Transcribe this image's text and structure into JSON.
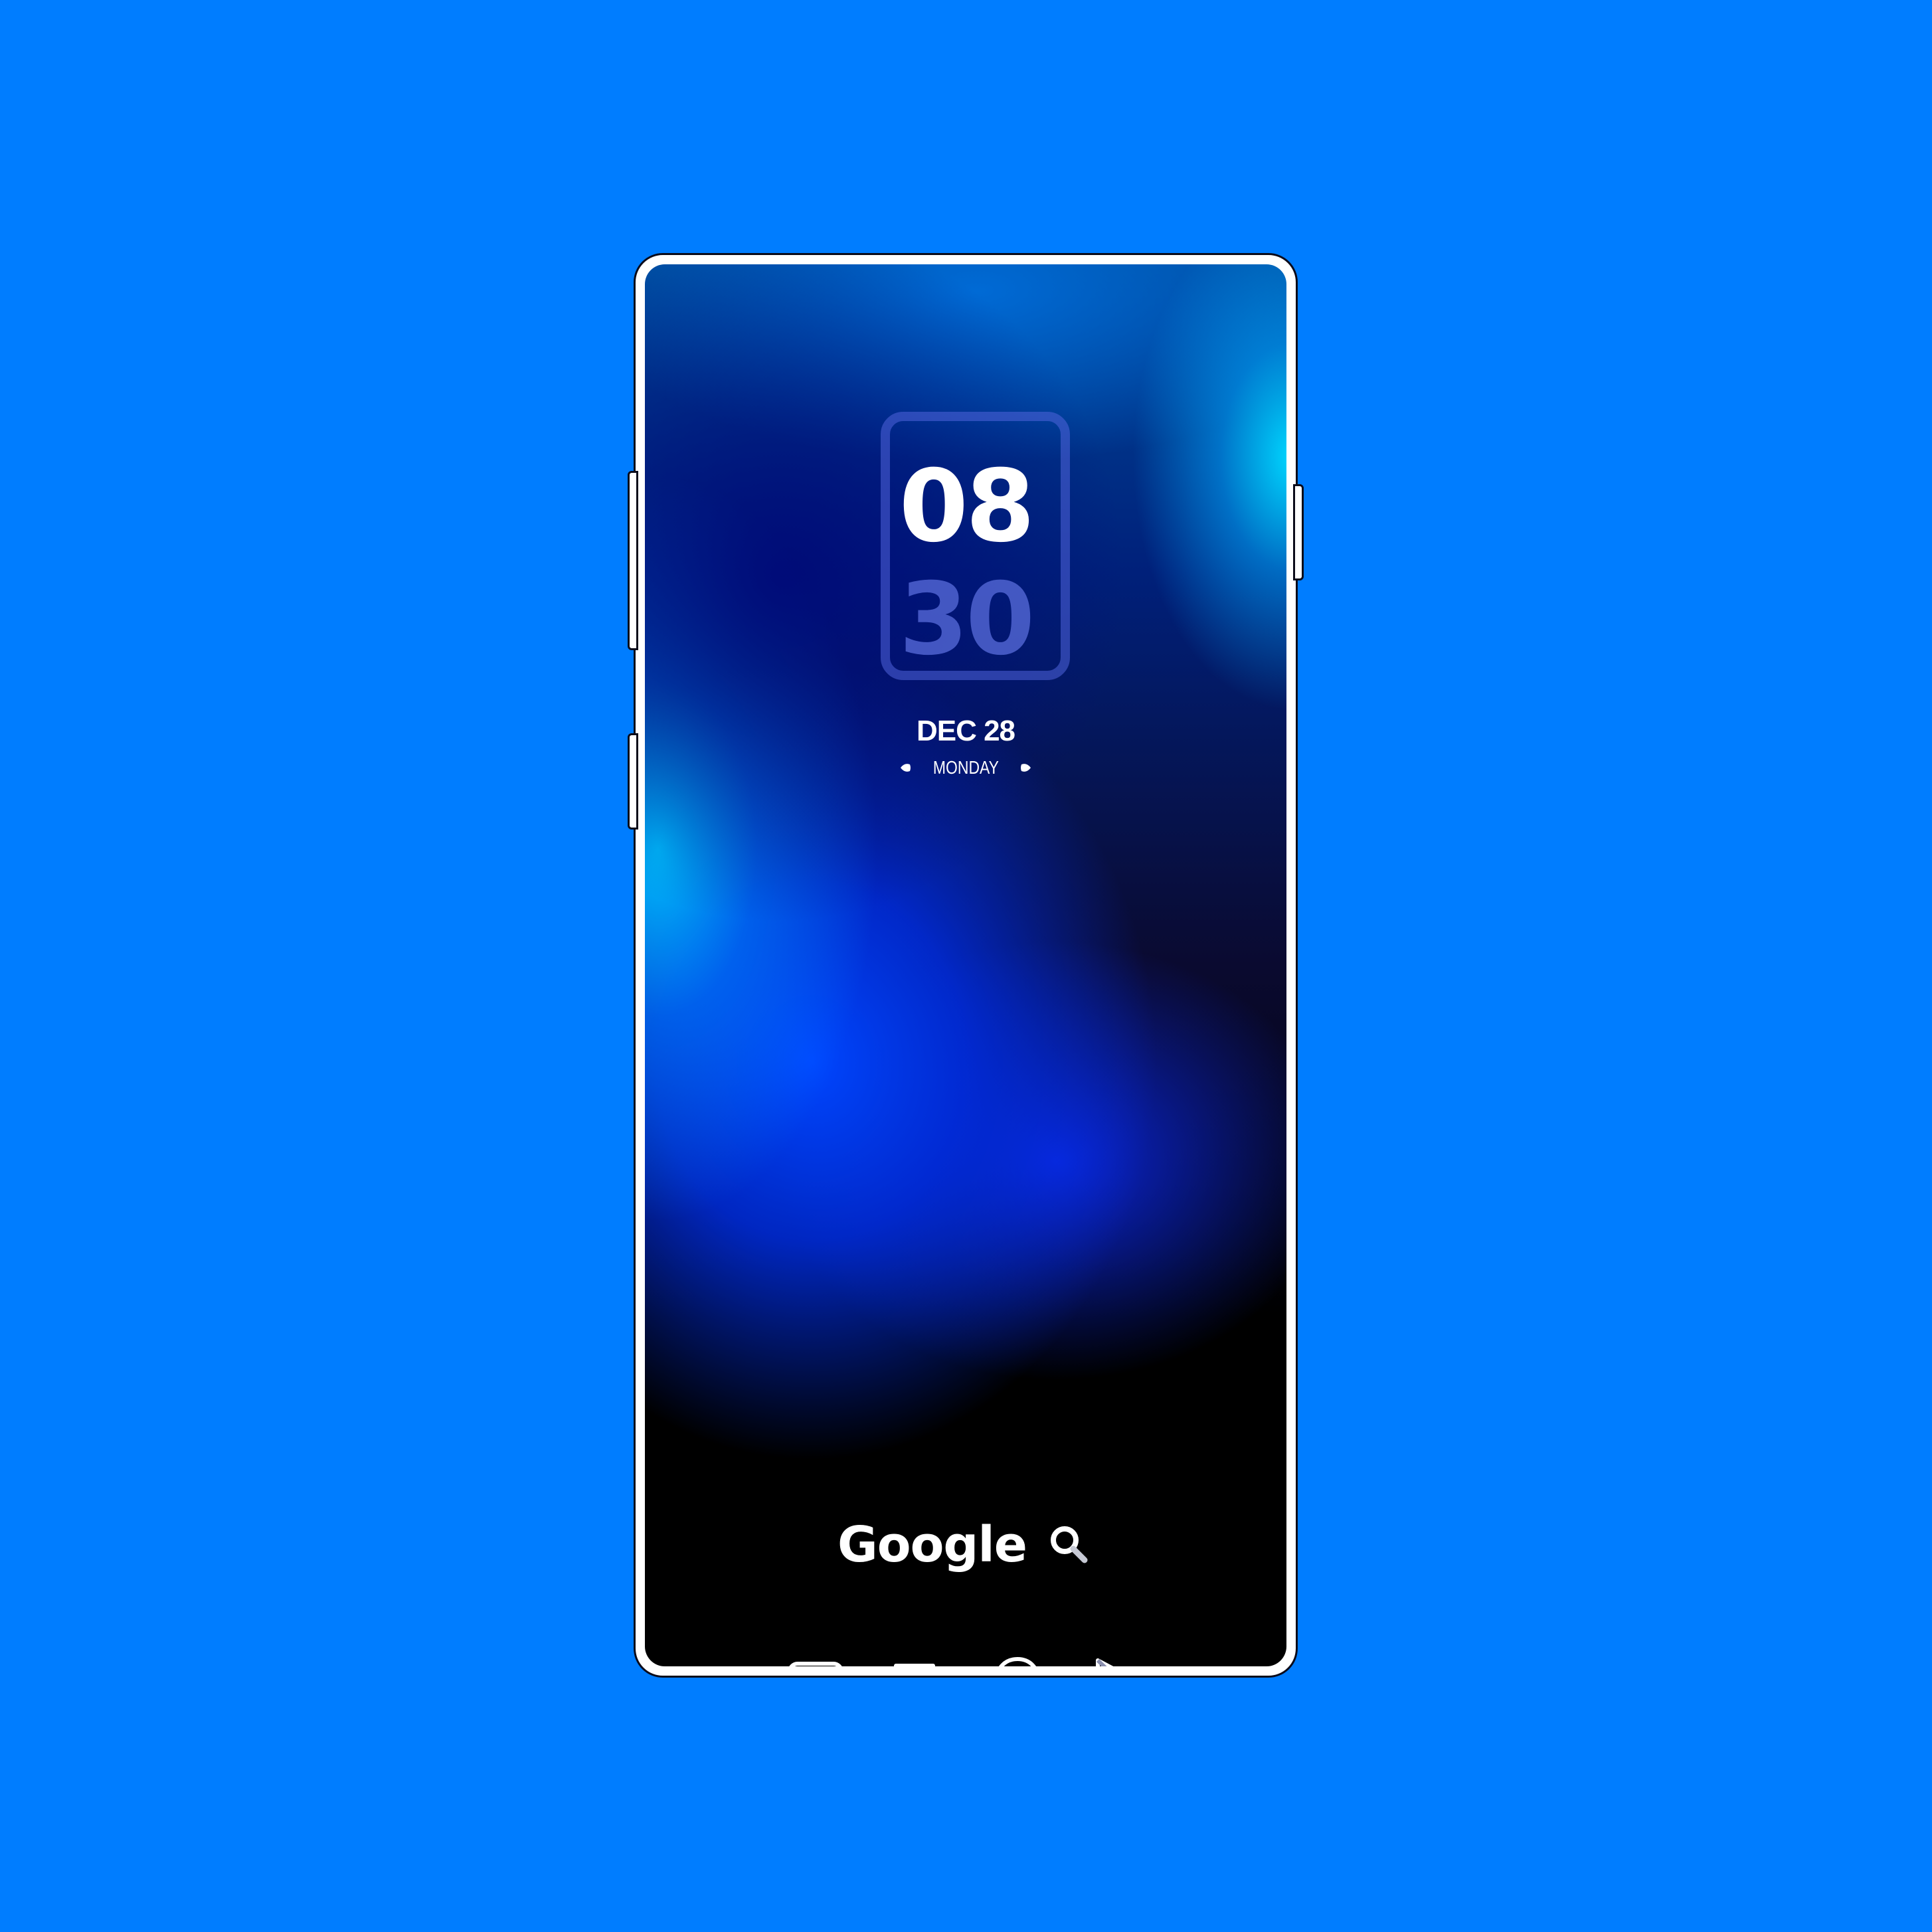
{
  "clock": {
    "hours": "08",
    "minutes": "30"
  },
  "date": {
    "date_text": "DEC 28",
    "weekday": "MONDAY"
  },
  "search_widget": {
    "brand": "Google"
  },
  "dock": {
    "row1": [
      "youtube-icon",
      "readwise-icon",
      "google-bulb-icon",
      "play-store-icon"
    ],
    "row2": [
      "camera-icon",
      "planet-browser-icon",
      "chat-bubble-icon",
      "reddit-icon"
    ]
  },
  "colors": {
    "background": "#007dff",
    "phone_frame": "#ffffff",
    "icon_stroke": "#ffffff",
    "clock_minutes": "#5a6edc"
  }
}
